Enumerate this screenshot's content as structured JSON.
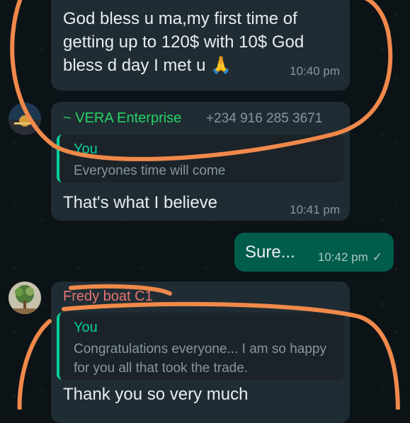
{
  "messages": [
    {
      "text": "God bless u ma,my first time of getting up to 120$ with 10$ God bless d day I met u 🙏",
      "time": "10:40 pm"
    },
    {
      "sender_name": "~ VERA Enterprise",
      "sender_phone": "+234 916 285 3671",
      "quote_author": "You",
      "quote_text": "Everyones time will come",
      "text": "That's what I believe",
      "time": "10:41 pm"
    },
    {
      "text": "Sure...",
      "time": "10:42 pm"
    },
    {
      "sender_name": "Fredy boat C1",
      "quote_author": "You",
      "quote_text": "Congratulations everyone... I am so happy for you all that took the trade.",
      "text": "Thank you so very much"
    }
  ],
  "colors": {
    "background": "#0c1317",
    "incoming_bubble": "#202c33",
    "outgoing_bubble": "#005c4b",
    "accent": "#06cf9c",
    "annotation": "#f0894a"
  },
  "icons": {
    "read_receipt": "single-check-icon"
  }
}
